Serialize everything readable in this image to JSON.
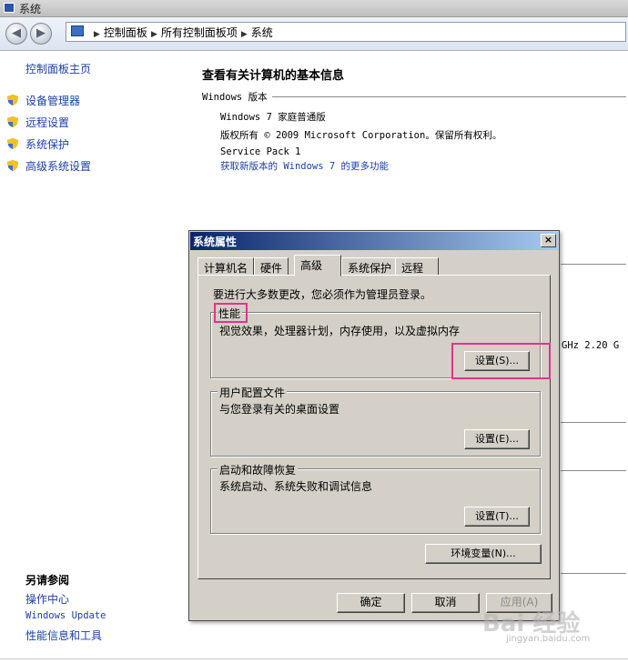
{
  "window": {
    "title": "系统"
  },
  "address": {
    "crumbs": [
      "控制面板",
      "所有控制面板项",
      "系统"
    ]
  },
  "left": {
    "home": "控制面板主页",
    "links": [
      "设备管理器",
      "远程设置",
      "系统保护",
      "高级系统设置"
    ],
    "see_also_title": "另请参阅",
    "see_also": [
      "操作中心",
      "Windows Update",
      "性能信息和工具"
    ]
  },
  "main": {
    "heading": "查看有关计算机的基本信息",
    "edition_label": "Windows 版本",
    "edition": "Windows 7 家庭普通版",
    "copyright": "版权所有 © 2009 Microsoft Corporation。保留所有权利。",
    "service_pack": "Service Pack 1",
    "more_features": "获取新版本的 Windows 7 的更多功能",
    "cpu_fragment": "GHz   2.20 G"
  },
  "dialog": {
    "title": "系统属性",
    "close": "×",
    "tabs": [
      "计算机名",
      "硬件",
      "高级",
      "系统保护",
      "远程"
    ],
    "active_tab": "高级",
    "admin_note": "要进行大多数更改，您必须作为管理员登录。",
    "performance": {
      "title": "性能",
      "desc": "视觉效果，处理器计划，内存使用，以及虚拟内存",
      "button": "设置(S)..."
    },
    "profiles": {
      "title": "用户配置文件",
      "desc": "与您登录有关的桌面设置",
      "button": "设置(E)..."
    },
    "startup": {
      "title": "启动和故障恢复",
      "desc": "系统启动、系统失败和调试信息",
      "button": "设置(T)..."
    },
    "env_button": "环境变量(N)...",
    "ok": "确定",
    "cancel": "取消",
    "apply": "应用(A)"
  },
  "watermark": {
    "brand": "Bai 经验",
    "url": "jingyan.baidu.com"
  },
  "colors": {
    "link": "#1c3fa8",
    "highlight": "#e0348f",
    "arrow": "#e3192a",
    "dialog_bg": "#d4d0c8"
  }
}
